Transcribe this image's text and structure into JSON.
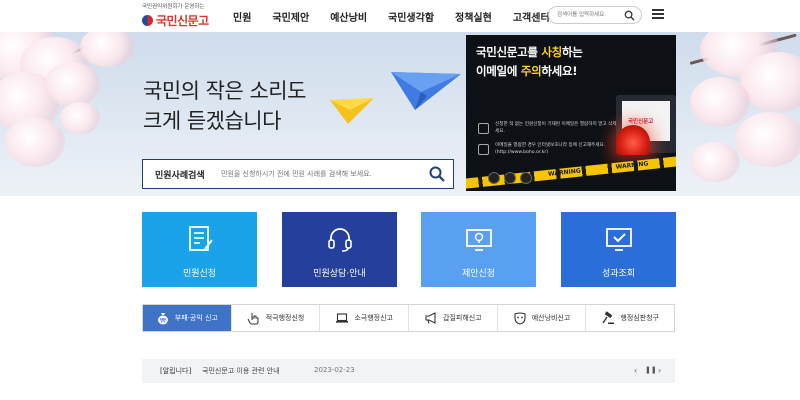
{
  "header": {
    "logo_tagline": "국민권익위원회가 운영하는",
    "logo_name": "국민신문고",
    "nav": [
      "민원",
      "국민제안",
      "예산낭비",
      "국민생각함",
      "정책실현",
      "고객센터"
    ],
    "search_placeholder": "검색어를 입력하세요."
  },
  "hero": {
    "title_line1": "국민의 작은 소리도",
    "title_line2": "크게 듣겠습니다",
    "search_label": "민원사례검색",
    "search_placeholder": "민원을 신청하시기 전에 민원 사례를 검색해 보세요."
  },
  "banner": {
    "line1_a": "국민신문고를 ",
    "line1_b": "사칭",
    "line1_c": "하는",
    "line2_a": "이메일에 ",
    "line2_b": "주의",
    "line2_c": "하세요!",
    "item1": "신청한 적 없는 민원신청이 기재된 이메일은 열람하지 말고 삭제해주세요.",
    "item2": "이메일을 열람한 경우 인터넷보호나라 등에 신고해주세요. (http://www.boho.or.kr)",
    "screen_text": "국민신문고",
    "tape_text": "WARNING",
    "accent_color": "#ffcf1f"
  },
  "tiles": [
    {
      "label": "민원신청",
      "icon": "document-edit-icon",
      "color": "#1aa3e8"
    },
    {
      "label": "민원상담·안내",
      "icon": "headset-icon",
      "color": "#253f9c"
    },
    {
      "label": "제안신청",
      "icon": "monitor-lightbulb-icon",
      "color": "#5aa0f0"
    },
    {
      "label": "성과조회",
      "icon": "monitor-check-icon",
      "color": "#2b6ed9"
    }
  ],
  "categories": [
    {
      "label": "부패·공익 신고",
      "icon": "money-bag-icon",
      "active": true
    },
    {
      "label": "적극행정신청",
      "icon": "hand-pointer-icon",
      "active": false
    },
    {
      "label": "소극행정신고",
      "icon": "laptop-icon",
      "active": false
    },
    {
      "label": "갑질피해신고",
      "icon": "megaphone-icon",
      "active": false
    },
    {
      "label": "예산낭비신고",
      "icon": "mask-icon",
      "active": false
    },
    {
      "label": "행정심판청구",
      "icon": "gavel-icon",
      "active": false
    }
  ],
  "notice": {
    "label": "[알립니다]",
    "title": "국민신문고 이용 관련 안내",
    "date": "2023-02-23"
  }
}
